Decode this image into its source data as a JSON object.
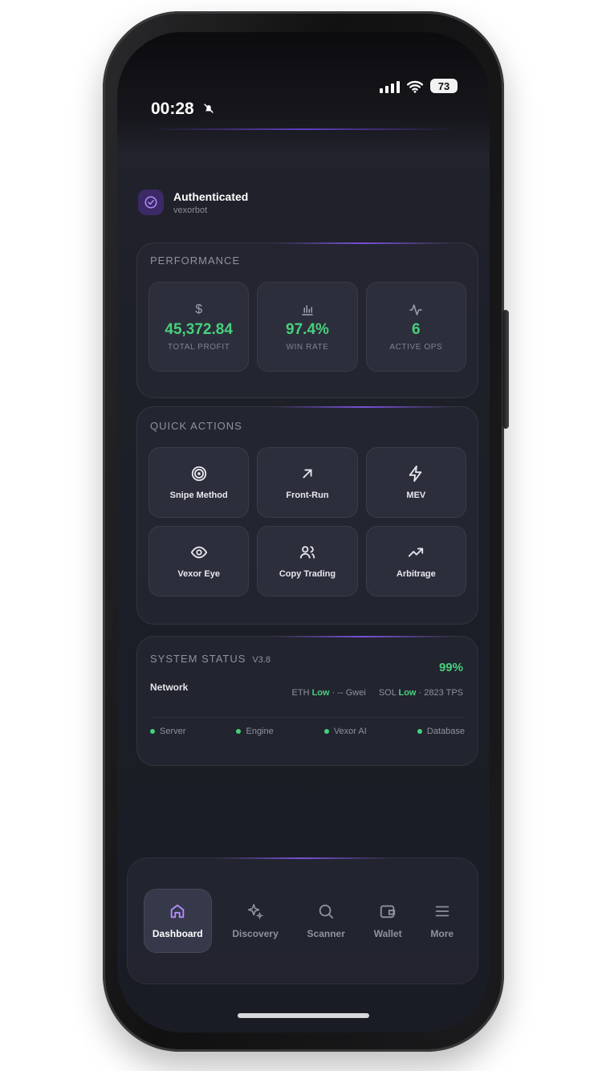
{
  "status_bar": {
    "time": "00:28",
    "battery": "73"
  },
  "auth": {
    "title": "Authenticated",
    "subtitle": "vexorbot"
  },
  "performance": {
    "title": "PERFORMANCE",
    "stats": [
      {
        "icon": "dollar-icon",
        "value": "45,372.84",
        "label": "TOTAL PROFIT"
      },
      {
        "icon": "bar-chart-icon",
        "value": "97.4%",
        "label": "WIN RATE"
      },
      {
        "icon": "activity-icon",
        "value": "6",
        "label": "ACTIVE OPS"
      }
    ]
  },
  "quick_actions": {
    "title": "QUICK ACTIONS",
    "items": [
      {
        "icon": "target-icon",
        "label": "Snipe Method"
      },
      {
        "icon": "arrow-up-right-icon",
        "label": "Front-Run"
      },
      {
        "icon": "lightning-icon",
        "label": "MEV"
      },
      {
        "icon": "eye-icon",
        "label": "Vexor Eye"
      },
      {
        "icon": "users-icon",
        "label": "Copy Trading"
      },
      {
        "icon": "trending-up-icon",
        "label": "Arbitrage"
      }
    ]
  },
  "system_status": {
    "title": "SYSTEM STATUS",
    "version": "v3.8",
    "uptime": "99%",
    "network_label": "Network",
    "eth": {
      "name": "ETH",
      "level": "Low",
      "detail": "· -- Gwei"
    },
    "sol": {
      "name": "SOL",
      "level": "Low",
      "detail": "· 2823 TPS"
    },
    "services": [
      "Server",
      "Engine",
      "Vexor AI",
      "Database"
    ]
  },
  "nav": {
    "items": [
      {
        "icon": "home-icon",
        "label": "Dashboard",
        "active": true
      },
      {
        "icon": "sparkle-icon",
        "label": "Discovery",
        "active": false
      },
      {
        "icon": "search-icon",
        "label": "Scanner",
        "active": false
      },
      {
        "icon": "wallet-icon",
        "label": "Wallet",
        "active": false
      },
      {
        "icon": "menu-icon",
        "label": "More",
        "active": false
      }
    ]
  },
  "colors": {
    "accent": "#7c4dff",
    "positive": "#46d17c",
    "background": "#1e2029"
  }
}
